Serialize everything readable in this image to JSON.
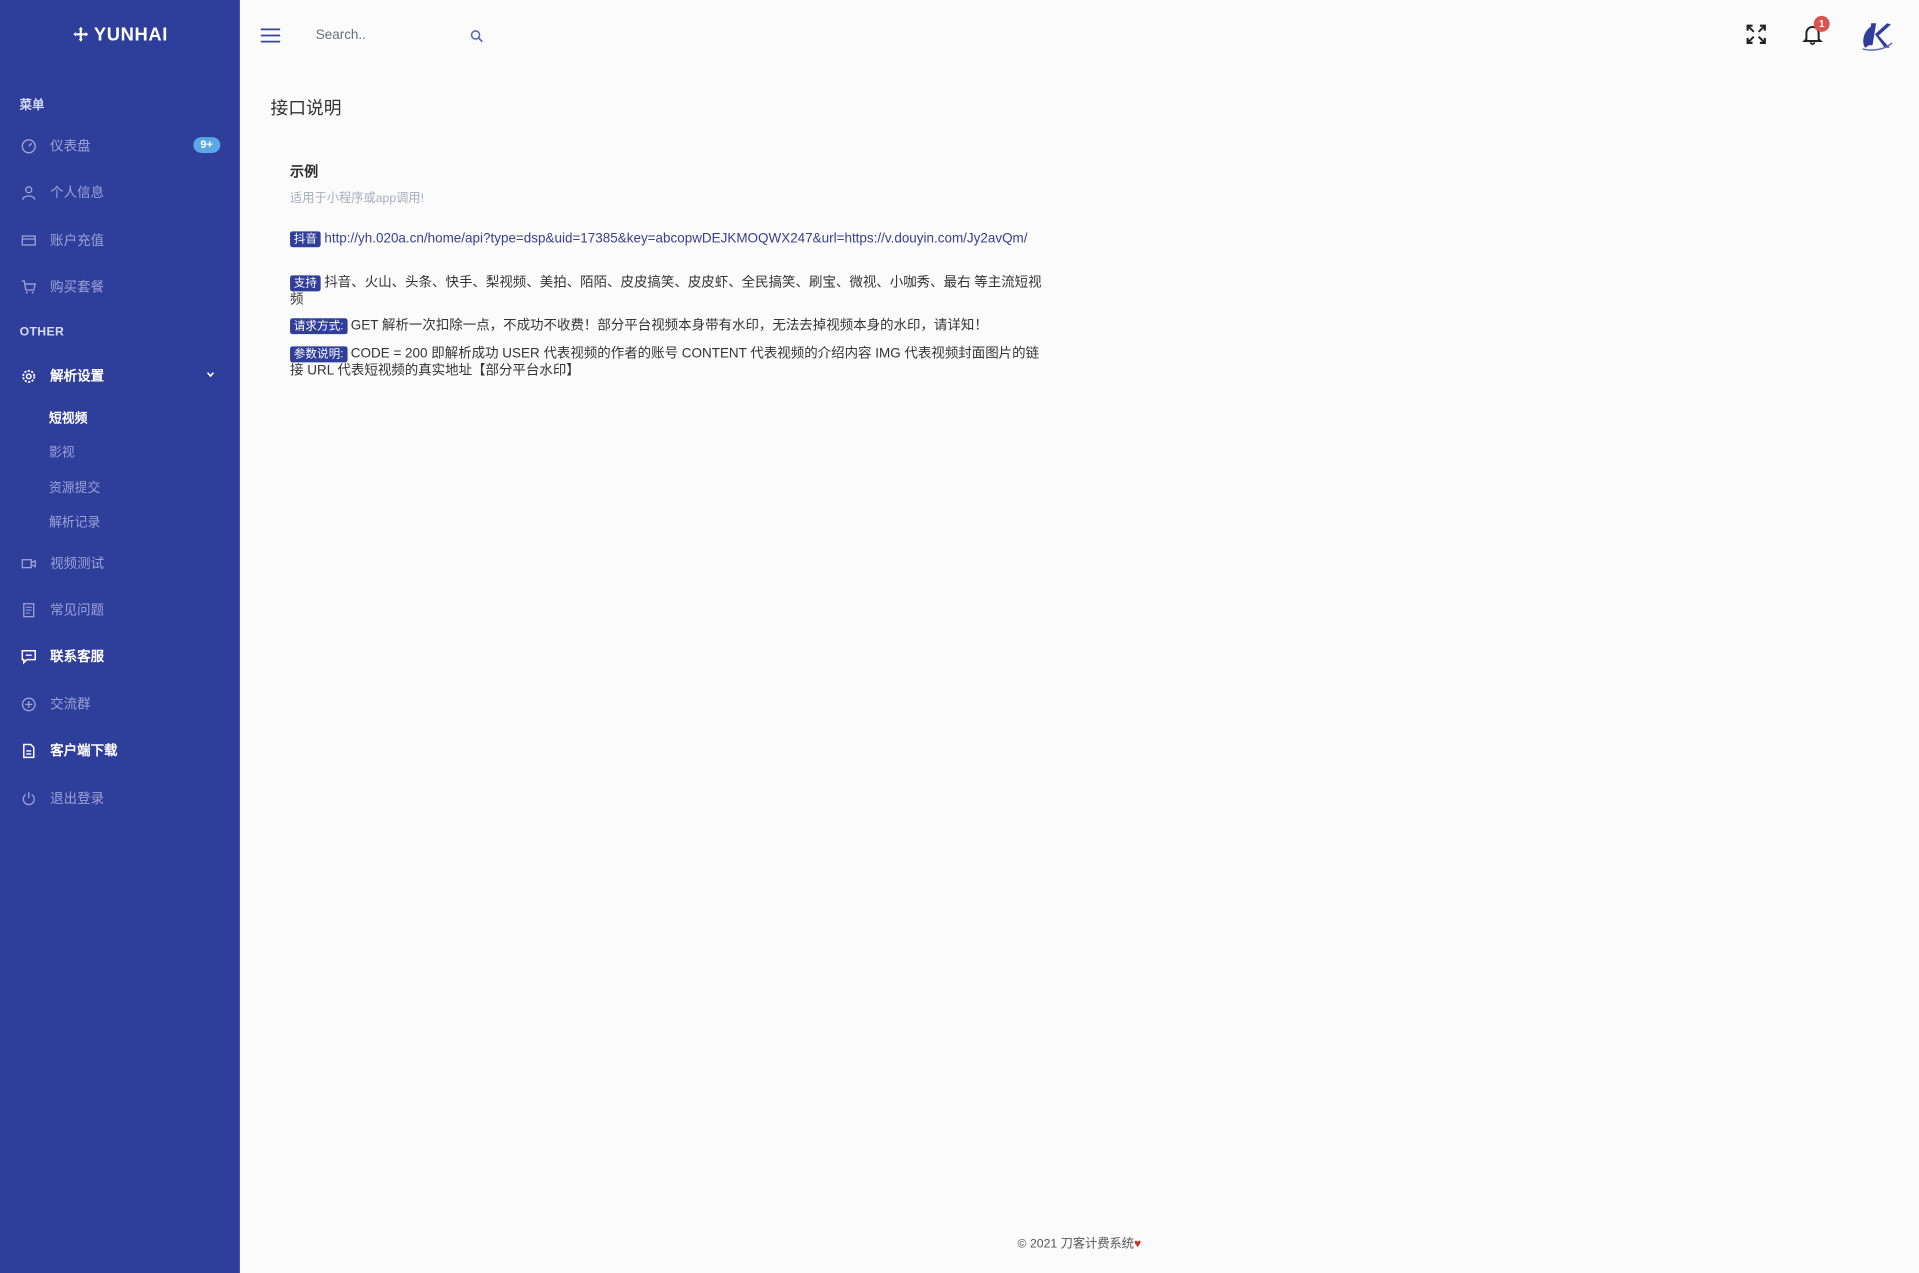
{
  "brand": {
    "name": "YUNHAI",
    "icon": "move-icon"
  },
  "sidebar": {
    "section_menu": "菜单",
    "section_other": "OTHER",
    "items": [
      {
        "label": "仪表盘",
        "icon": "dashboard-icon",
        "badge": "9+"
      },
      {
        "label": "个人信息",
        "icon": "user-icon"
      },
      {
        "label": "账户充值",
        "icon": "credit-card-icon"
      },
      {
        "label": "购买套餐",
        "icon": "cart-icon"
      }
    ],
    "other_items": [
      {
        "label": "解析设置",
        "icon": "gear-icon"
      },
      {
        "label": "视频测试",
        "icon": "video-icon"
      },
      {
        "label": "常见问题",
        "icon": "document-icon"
      },
      {
        "label": "联系客服",
        "icon": "chat-icon"
      },
      {
        "label": "交流群",
        "icon": "plus-circle-icon"
      },
      {
        "label": "客户端下载",
        "icon": "file-icon"
      },
      {
        "label": "退出登录",
        "icon": "power-icon"
      }
    ],
    "sub_items": [
      {
        "label": "短视频"
      },
      {
        "label": "影视"
      },
      {
        "label": "资源提交"
      },
      {
        "label": "解析记录"
      }
    ]
  },
  "topbar": {
    "search_placeholder": "Search..",
    "notification_count": "1",
    "icons": [
      "menu-icon",
      "search-icon",
      "fullscreen-icon",
      "bell-icon",
      "avatar"
    ]
  },
  "main": {
    "page_title": "接口说明",
    "card_title": "示例",
    "card_subtitle": "适用于小程序或app调用!",
    "lines": [
      {
        "tag": "抖音",
        "text": "http://yh.020a.cn/home/api?type=dsp&uid=17385&key=abcopwDEJKMOQWX247&url=https://v.douyin.com/Jy2avQm/"
      },
      {
        "tag": "支持",
        "text": "抖音、火山、头条、快手、梨视频、美拍、陌陌、皮皮搞笑、皮皮虾、全民搞笑、刷宝、微视、小咖秀、最右 等主流短视频"
      },
      {
        "tag": "请求方式:",
        "text": "GET 解析一次扣除一点，不成功不收费！部分平台视频本身带有水印，无法去掉视频本身的水印，请详知！"
      },
      {
        "tag": "参数说明:",
        "text": "CODE = 200 即解析成功 USER 代表视频的作者的账号 CONTENT 代表视频的介绍内容 IMG 代表视频封面图片的链接 URL 代表短视频的真实地址【部分平台水印】"
      }
    ]
  },
  "footer": {
    "text": "© 2021 刀客计费系统",
    "heart": "♥"
  },
  "colors": {
    "sidebar_bg": "#2f3e9b",
    "badge": "#59a9e6",
    "tag_bg": "#2f3e9b",
    "notification": "#d9534f"
  }
}
